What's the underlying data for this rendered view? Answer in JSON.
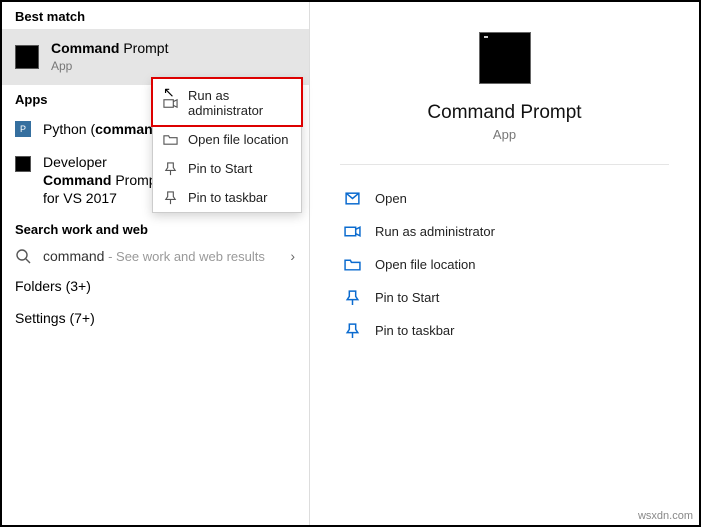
{
  "left": {
    "bestMatchHeader": "Best match",
    "bestMatchItem": {
      "title_bold": "Command",
      "title_rest": " Prompt",
      "sub": "App"
    },
    "appsHeader": "Apps",
    "apps": [
      {
        "pre": "Python (",
        "bold": "command",
        "post": " ..."
      },
      {
        "pre": "Developer ",
        "bold": "Command",
        "post": " Prompt for VS 2017"
      }
    ],
    "searchHeader": "Search work and web",
    "searchQuery": "command",
    "searchHint": " - See work and web results",
    "categories": [
      "Folders (3+)",
      "Settings (7+)"
    ]
  },
  "contextMenu": {
    "items": [
      "Run as administrator",
      "Open file location",
      "Pin to Start",
      "Pin to taskbar"
    ]
  },
  "detail": {
    "title": "Command Prompt",
    "sub": "App",
    "actions": [
      "Open",
      "Run as administrator",
      "Open file location",
      "Pin to Start",
      "Pin to taskbar"
    ]
  },
  "watermark": "wsxdn.com"
}
